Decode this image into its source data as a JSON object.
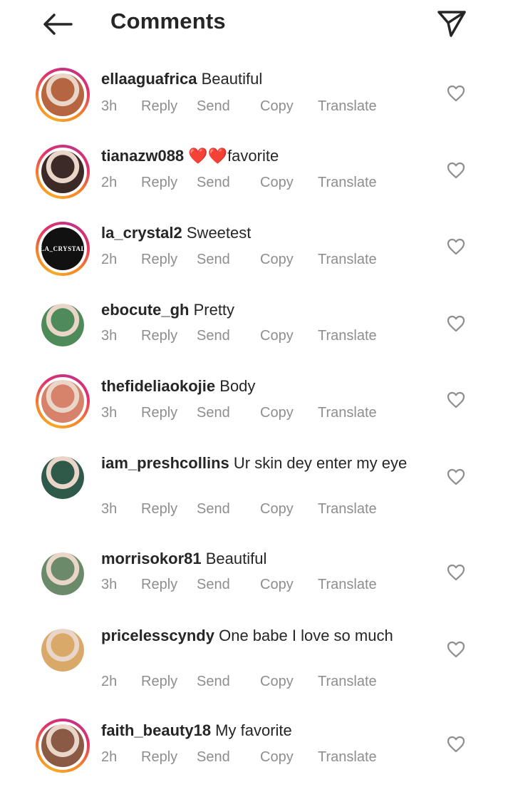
{
  "header": {
    "title": "Comments",
    "back_icon": "arrow-left-icon",
    "send_icon": "paper-plane-icon"
  },
  "actions": {
    "reply": "Reply",
    "send": "Send",
    "copy": "Copy",
    "translate": "Translate"
  },
  "comments": [
    {
      "username": "ellaaguafrica",
      "text": " Beautiful",
      "time": "3h",
      "has_story_ring": true,
      "avatar_color": "#b5653f"
    },
    {
      "username": "tianazw088",
      "text": " ❤️❤️favorite",
      "time": "2h",
      "has_story_ring": true,
      "avatar_color": "#3b2a25"
    },
    {
      "username": "la_crystal2",
      "text": " Sweetest",
      "time": "2h",
      "has_story_ring": true,
      "avatar_color": "#111111",
      "avatar_label": "LA_CRYSTAL"
    },
    {
      "username": "ebocute_gh",
      "text": " Pretty",
      "time": "3h",
      "has_story_ring": false,
      "avatar_color": "#4f8a5b"
    },
    {
      "username": "thefideliaokojie",
      "text": " Body",
      "time": "3h",
      "has_story_ring": true,
      "avatar_color": "#d7826a"
    },
    {
      "username": "iam_preshcollins",
      "text": " Ur skin dey enter my eye",
      "time": "3h",
      "has_story_ring": false,
      "avatar_color": "#2f5a4a"
    },
    {
      "username": "morrisokor81",
      "text": " Beautiful",
      "time": "3h",
      "has_story_ring": false,
      "avatar_color": "#6a8a6a"
    },
    {
      "username": "pricelesscyndy",
      "text": " One babe I love so much",
      "time": "2h",
      "has_story_ring": false,
      "avatar_color": "#d9a96a"
    },
    {
      "username": "faith_beauty18",
      "text": " My favorite",
      "time": "2h",
      "has_story_ring": true,
      "avatar_color": "#8a5a45"
    }
  ],
  "colors": {
    "text": "#262626",
    "secondary": "#8e8e8e",
    "ring_start": "#f9a825",
    "ring_end": "#c13584"
  }
}
